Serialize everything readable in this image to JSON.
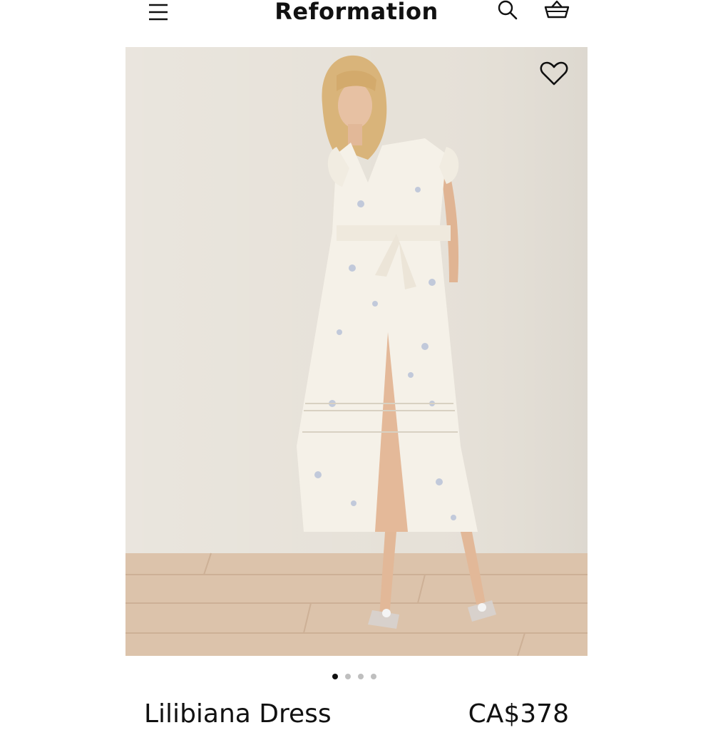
{
  "header": {
    "brand": "Reformation",
    "menu_icon": "hamburger-menu-icon",
    "search_icon": "search-icon",
    "bag_icon": "shopping-bag-icon"
  },
  "product": {
    "image": "model in white floral midi dress with tie waist",
    "wishlist_icon": "heart-icon",
    "name": "Lilibiana Dress",
    "price": "CA$378"
  },
  "carousel": {
    "count": 4,
    "active_index": 0
  },
  "colors": {
    "text": "#111111",
    "background": "#ffffff",
    "dot_inactive": "#bfbfbf"
  }
}
